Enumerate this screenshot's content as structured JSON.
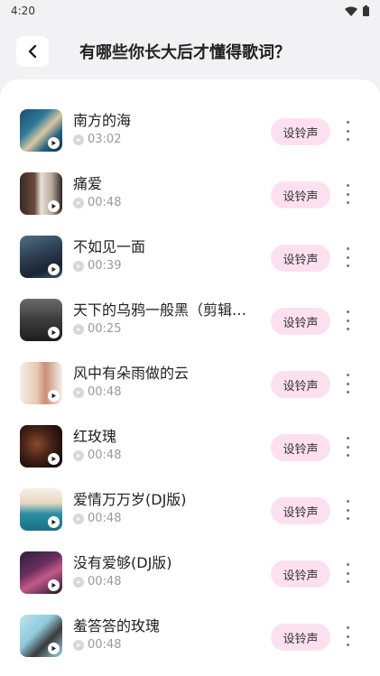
{
  "status": {
    "time": "4:20"
  },
  "header": {
    "title": "有哪些你长大后才懂得歌词？"
  },
  "ringtone_label": "设铃声",
  "songs": [
    {
      "title": "南方的海",
      "duration": "03:02"
    },
    {
      "title": "痛爱",
      "duration": "00:48"
    },
    {
      "title": "不如见一面",
      "duration": "00:39"
    },
    {
      "title": "天下的乌鸦一般黑（剪辑…",
      "duration": "00:25"
    },
    {
      "title": "风中有朵雨做的云",
      "duration": "00:48"
    },
    {
      "title": "红玫瑰",
      "duration": "00:48"
    },
    {
      "title": "爱情万万岁(DJ版)",
      "duration": "00:48"
    },
    {
      "title": "没有爱够(DJ版)",
      "duration": "00:48"
    },
    {
      "title": "羞答答的玫瑰",
      "duration": "00:48"
    }
  ],
  "colors": {
    "accent_pill": "#fde0ef",
    "card": "#ffffff",
    "page_bg": "#f2f2f4"
  }
}
